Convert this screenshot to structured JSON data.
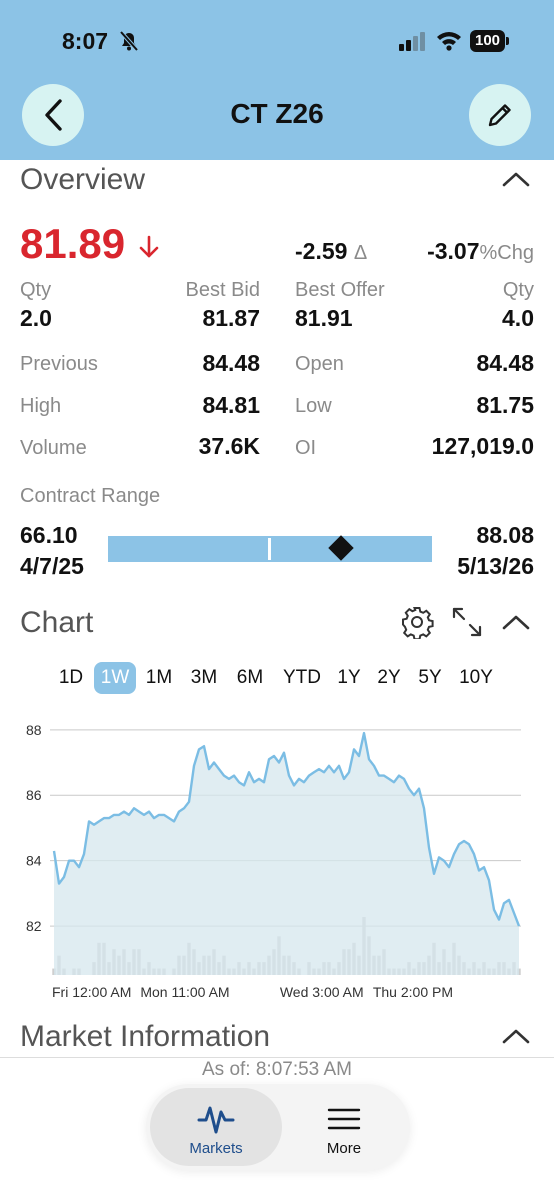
{
  "status": {
    "time": "8:07",
    "battery": "100"
  },
  "header": {
    "title": "CT Z26"
  },
  "overview": {
    "title": "Overview",
    "last_price": "81.89",
    "net_change": "-2.59",
    "net_change_unit": "Δ",
    "pct_change": "-3.07",
    "pct_change_unit": "%Chg",
    "qty_bid_label": "Qty",
    "qty_bid": "2.0",
    "best_bid_label": "Best Bid",
    "best_bid": "81.87",
    "best_offer_label": "Best Offer",
    "best_offer": "81.91",
    "qty_offer_label": "Qty",
    "qty_offer": "4.0",
    "previous_label": "Previous",
    "previous": "84.48",
    "open_label": "Open",
    "open": "84.48",
    "high_label": "High",
    "high": "84.81",
    "low_label": "Low",
    "low": "81.75",
    "volume_label": "Volume",
    "volume": "37.6K",
    "oi_label": "OI",
    "oi": "127,019.0",
    "contract_range_label": "Contract Range",
    "range_low": "66.10",
    "range_low_date": "4/7/25",
    "range_high": "88.08",
    "range_high_date": "5/13/26",
    "range_current_fraction": 0.72,
    "range_marker_fraction": 0.5
  },
  "chart_section": {
    "title": "Chart",
    "timeframes": [
      "1D",
      "1W",
      "1M",
      "3M",
      "6M",
      "YTD",
      "1Y",
      "2Y",
      "5Y",
      "10Y"
    ],
    "active_timeframe": "1W"
  },
  "chart_data": {
    "type": "area",
    "y_ticks": [
      "88",
      "86",
      "84",
      "82"
    ],
    "ylim": [
      81.3,
      88.3
    ],
    "x_tick_labels": [
      "Fri 12:00 AM",
      "Mon 11:00 AM",
      "Wed 3:00 AM",
      "Thu 2:00 PM"
    ],
    "x_tick_positions": [
      0,
      0.19,
      0.49,
      0.69
    ],
    "line_color": "#7bbde4",
    "fill_color": "#d6e7ee",
    "price": [
      84.3,
      83.3,
      83.5,
      84.0,
      84.0,
      83.8,
      84.2,
      85.2,
      85.1,
      85.2,
      85.3,
      85.3,
      85.4,
      85.4,
      85.5,
      85.4,
      85.6,
      85.5,
      85.4,
      85.5,
      85.3,
      85.4,
      85.4,
      85.3,
      85.2,
      85.5,
      85.6,
      85.8,
      86.9,
      87.4,
      87.5,
      86.8,
      87.0,
      86.8,
      86.6,
      86.5,
      86.6,
      86.4,
      86.3,
      86.7,
      86.4,
      86.5,
      86.4,
      87.1,
      87.2,
      87.0,
      87.3,
      86.6,
      86.3,
      86.5,
      86.4,
      86.6,
      86.7,
      86.8,
      86.7,
      86.9,
      86.7,
      86.9,
      86.5,
      86.7,
      87.4,
      87.2,
      87.9,
      87.1,
      86.9,
      86.6,
      86.6,
      86.5,
      86.4,
      86.6,
      86.5,
      86.2,
      86.0,
      86.2,
      85.6,
      84.4,
      83.6,
      84.1,
      84.0,
      83.8,
      84.2,
      84.5,
      84.6,
      84.5,
      84.2,
      83.7,
      83.8,
      83.4,
      82.5,
      82.2,
      82.7,
      82.8,
      82.4,
      82.0
    ],
    "volume": [
      1,
      3,
      1,
      0,
      1,
      1,
      0,
      0,
      2,
      5,
      5,
      2,
      4,
      3,
      4,
      2,
      4,
      4,
      1,
      2,
      1,
      1,
      1,
      0,
      1,
      3,
      3,
      5,
      4,
      2,
      3,
      3,
      4,
      2,
      3,
      1,
      1,
      2,
      1,
      2,
      1,
      2,
      2,
      3,
      4,
      6,
      3,
      3,
      2,
      1,
      0,
      2,
      1,
      1,
      2,
      2,
      1,
      2,
      4,
      4,
      5,
      3,
      9,
      6,
      3,
      3,
      4,
      1,
      1,
      1,
      1,
      2,
      1,
      2,
      2,
      3,
      5,
      2,
      4,
      2,
      5,
      3,
      2,
      1,
      2,
      1,
      2,
      1,
      1,
      2,
      2,
      1,
      2,
      1
    ]
  },
  "market_info": {
    "title": "Market Information",
    "as_of": "As of: 8:07:53 AM"
  },
  "tabs": {
    "markets": "Markets",
    "more": "More"
  }
}
